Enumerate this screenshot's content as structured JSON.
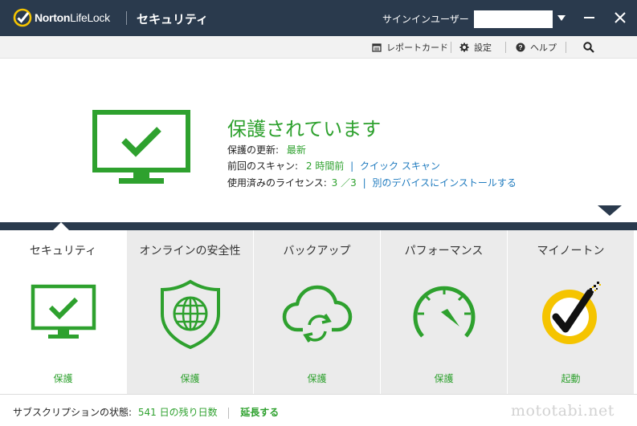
{
  "titlebar": {
    "brand_bold": "Norton",
    "brand_light": "LifeLock",
    "app_title": "セキュリティ",
    "signin_label": "サインインユーザー",
    "minimize_icon": "minimize-icon",
    "close_icon": "close-icon"
  },
  "toolbar": {
    "report_card": "レポートカード",
    "settings": "設定",
    "help": "ヘルプ"
  },
  "status": {
    "title": "保護されています",
    "update_label": "保護の更新:",
    "update_value": "最新",
    "scan_label": "前回のスキャン:",
    "scan_value": "2 時間前",
    "quick_scan": "クイック スキャン",
    "license_label": "使用済みのライセンス:",
    "license_value": "3 ／3",
    "install_other": "別のデバイスにインストールする"
  },
  "tiles": [
    {
      "title": "セキュリティ",
      "status": "保護",
      "icon": "monitor-check-icon"
    },
    {
      "title": "オンラインの安全性",
      "status": "保護",
      "icon": "shield-globe-icon"
    },
    {
      "title": "バックアップ",
      "status": "保護",
      "icon": "cloud-sync-icon"
    },
    {
      "title": "パフォーマンス",
      "status": "保護",
      "icon": "speedometer-icon"
    },
    {
      "title": "マイノートン",
      "status": "起動",
      "icon": "norton-seal-icon"
    }
  ],
  "footer": {
    "subscription_label": "サブスクリプションの状態:",
    "days_left": "541 日の残り日数",
    "renew": "延長する",
    "watermark": "mototabi.net"
  },
  "colors": {
    "titlebar": "#2a3a4d",
    "status_green": "#2ea12e",
    "link_blue": "#1f7bbf",
    "norton_yellow": "#f5c400"
  }
}
